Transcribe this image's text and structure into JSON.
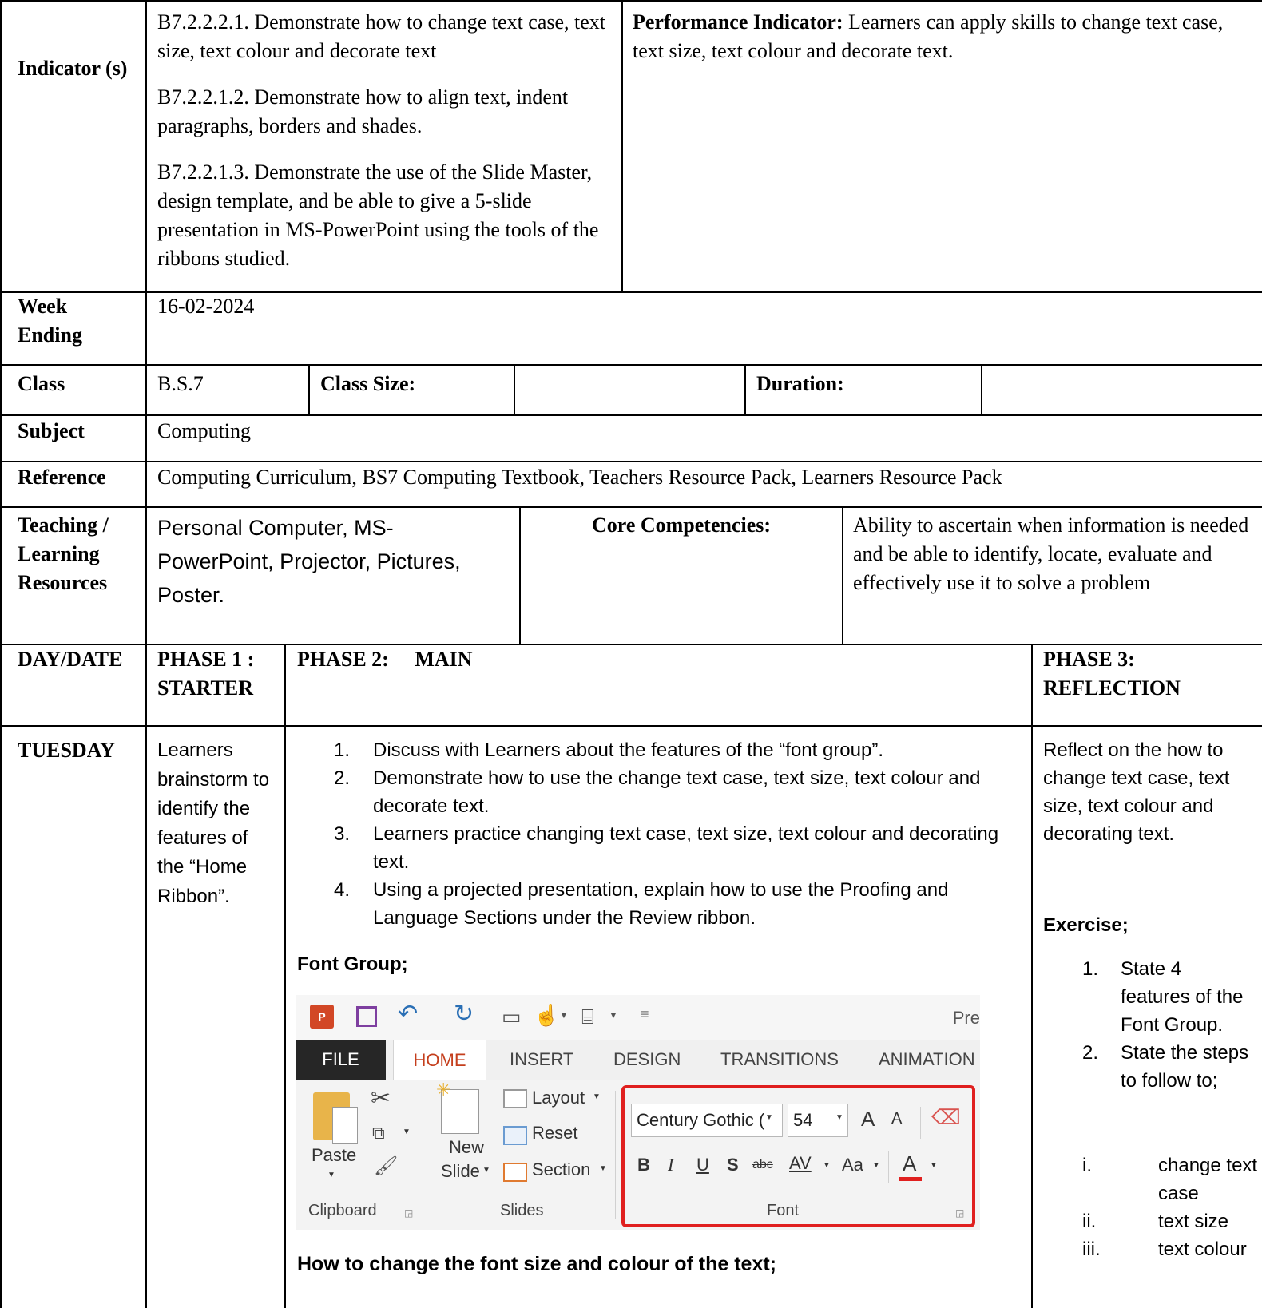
{
  "indicator": {
    "label": "Indicator (s)",
    "items": [
      "B7.2.2.2.1. Demonstrate how to change text case, text size, text colour and decorate text",
      "B7.2.2.1.2. Demonstrate how to align text, indent paragraphs, borders and shades.",
      "B7.2.2.1.3. Demonstrate the use of the Slide Master, design template, and be able to give a 5-slide presentation in MS-PowerPoint using the tools of the ribbons studied."
    ],
    "performance_label": "Performance Indicator:",
    "performance_text": " Learners can apply skills to change text case, text size, text colour and decorate text."
  },
  "week": {
    "label": "Week Ending",
    "value": "16-02-2024"
  },
  "class_row": {
    "label": "Class",
    "value": "B.S.7",
    "size_label": "Class Size:",
    "size_value": "",
    "duration_label": "Duration:",
    "duration_value": ""
  },
  "subject": {
    "label": "Subject",
    "value": "Computing"
  },
  "reference": {
    "label": "Reference",
    "value": "Computing Curriculum, BS7 Computing Textbook, Teachers Resource Pack, Learners Resource Pack"
  },
  "resources": {
    "label": "Teaching / Learning Resources",
    "value": "Personal Computer, MS-PowerPoint, Projector, Pictures, Poster.",
    "core_label": "Core Competencies:",
    "core_value": "Ability to ascertain when information is needed and be able to identify, locate, evaluate and effectively use it to solve a problem"
  },
  "phases": {
    "day_label": "DAY/DATE",
    "phase1": "PHASE 1 : STARTER",
    "phase2": "PHASE 2:     MAIN",
    "phase3": "PHASE 3: REFLECTION"
  },
  "tuesday": {
    "day": "TUESDAY",
    "starter": "Learners brainstorm to identify the features of the “Home Ribbon”.",
    "main_items": [
      {
        "n": "1.",
        "text": "Discuss with Learners about the features of the “font group”."
      },
      {
        "n": "2.",
        "text": "Demonstrate how to use the change text case, text size, text colour and decorate text."
      },
      {
        "n": "3.",
        "text": "Learners practice changing text case, text size, text colour and decorating text."
      },
      {
        "n": "4.",
        "text": "Using a projected presentation, explain how to use the Proofing and Language Sections under the Review ribbon."
      }
    ],
    "font_group_heading": "Font Group;",
    "how_to_heading": "How to change the font size and colour of the text;",
    "reflection": "Reflect on the how to change text case, text size, text colour and decorating text.",
    "exercise_heading": "Exercise;",
    "exercise_items": [
      {
        "n": "1.",
        "text": "State 4 features of the Font Group."
      },
      {
        "n": "2.",
        "text": "State the steps to follow to;"
      }
    ],
    "exercise_sub": [
      {
        "n": "i.",
        "text": "change text case"
      },
      {
        "n": "ii.",
        "text": "text size"
      },
      {
        "n": "iii.",
        "text": "text colour"
      }
    ]
  },
  "ribbon": {
    "title_partial": "Pre",
    "tabs": [
      "FILE",
      "HOME",
      "INSERT",
      "DESIGN",
      "TRANSITIONS",
      "ANIMATION"
    ],
    "paste": "Paste",
    "clipboard": "Clipboard",
    "new_slide_1": "New",
    "new_slide_2": "Slide",
    "layout": "Layout",
    "reset": "Reset",
    "section": "Section",
    "slides": "Slides",
    "font_name": "Century Gothic (",
    "font_size": "54",
    "font_label": "Font",
    "bold": "B",
    "italic": "I",
    "underline": "U",
    "shadow": "S",
    "strike": "abc",
    "spacing": "AV",
    "case": "Aa",
    "color": "A",
    "grow": "A",
    "shrink": "A",
    "accent_red": "#e0201f",
    "home_color": "#c43e1c"
  }
}
